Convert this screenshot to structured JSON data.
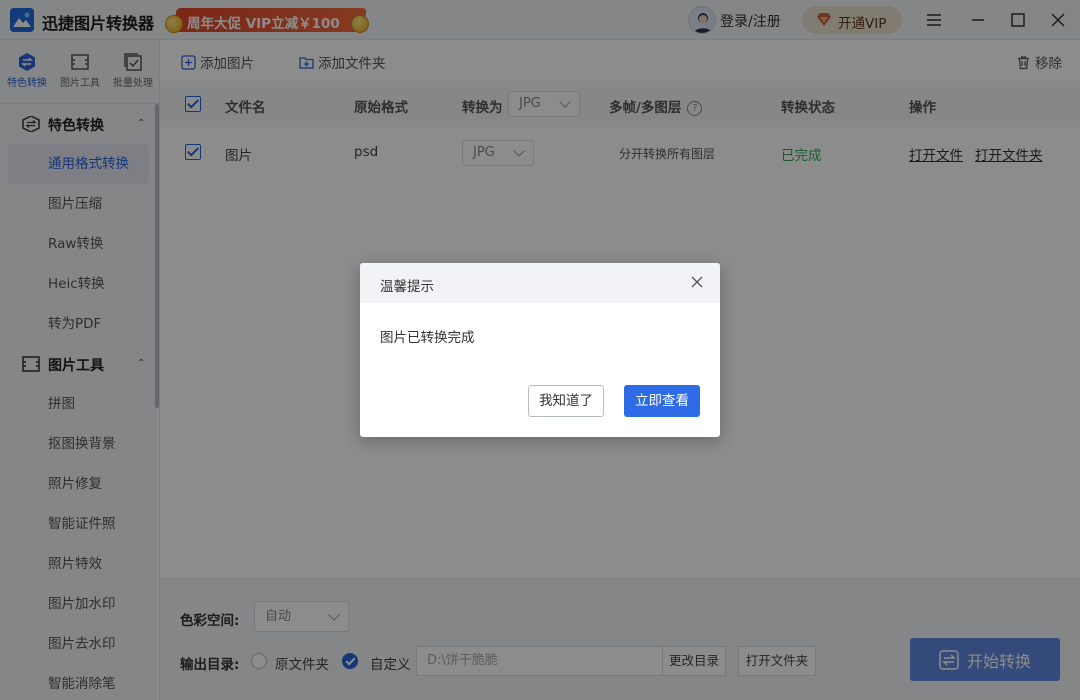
{
  "app": {
    "title": "迅捷图片转换器",
    "promo_text": "周年大促 VIP立减￥100",
    "login_label": "登录/注册",
    "vip_label": "开通VIP"
  },
  "icon_tabs": [
    {
      "label": "特色转换",
      "icon": "swap-circle-icon",
      "active": true
    },
    {
      "label": "图片工具",
      "icon": "image-tools-icon",
      "active": false
    },
    {
      "label": "批量处理",
      "icon": "batch-check-icon",
      "active": false
    }
  ],
  "sidebar": {
    "sections": [
      {
        "title": "特色转换",
        "icon": "swap-circle-icon",
        "items": [
          "通用格式转换",
          "图片压缩",
          "Raw转换",
          "Heic转换",
          "转为PDF"
        ]
      },
      {
        "title": "图片工具",
        "icon": "image-tools-icon",
        "items": [
          "拼图",
          "抠图换背景",
          "照片修复",
          "智能证件照",
          "照片特效",
          "图片加水印",
          "图片去水印",
          "智能消除笔"
        ]
      }
    ],
    "active_item": "通用格式转换"
  },
  "toolbar": {
    "add_image": "添加图片",
    "add_folder": "添加文件夹",
    "remove": "移除"
  },
  "table": {
    "headers": {
      "filename": "文件名",
      "original_format": "原始格式",
      "convert_to": "转换为",
      "convert_to_value": "JPG",
      "multiframe": "多帧/多图层",
      "status": "转换状态",
      "action": "操作"
    },
    "rows": [
      {
        "filename": "图片",
        "original_format": "psd",
        "convert_to": "JPG",
        "multiframe": "分开转换所有图层",
        "status": "已完成",
        "open_file": "打开文件",
        "open_folder": "打开文件夹"
      }
    ]
  },
  "bottom": {
    "color_space_label": "色彩空间:",
    "color_space_value": "自动",
    "output_label": "输出目录:",
    "option_original": "原文件夹",
    "option_custom": "自定义",
    "path_value": "D:\\饼干脆脆",
    "change_dir": "更改目录",
    "open_folder": "打开文件夹",
    "start": "开始转换"
  },
  "dialog": {
    "title": "温馨提示",
    "message": "图片已转换完成",
    "btn_ok": "我知道了",
    "btn_view": "立即查看"
  },
  "colors": {
    "accent": "#2d63d8",
    "status_done": "#3aa55b",
    "promo": "#e0472a"
  }
}
